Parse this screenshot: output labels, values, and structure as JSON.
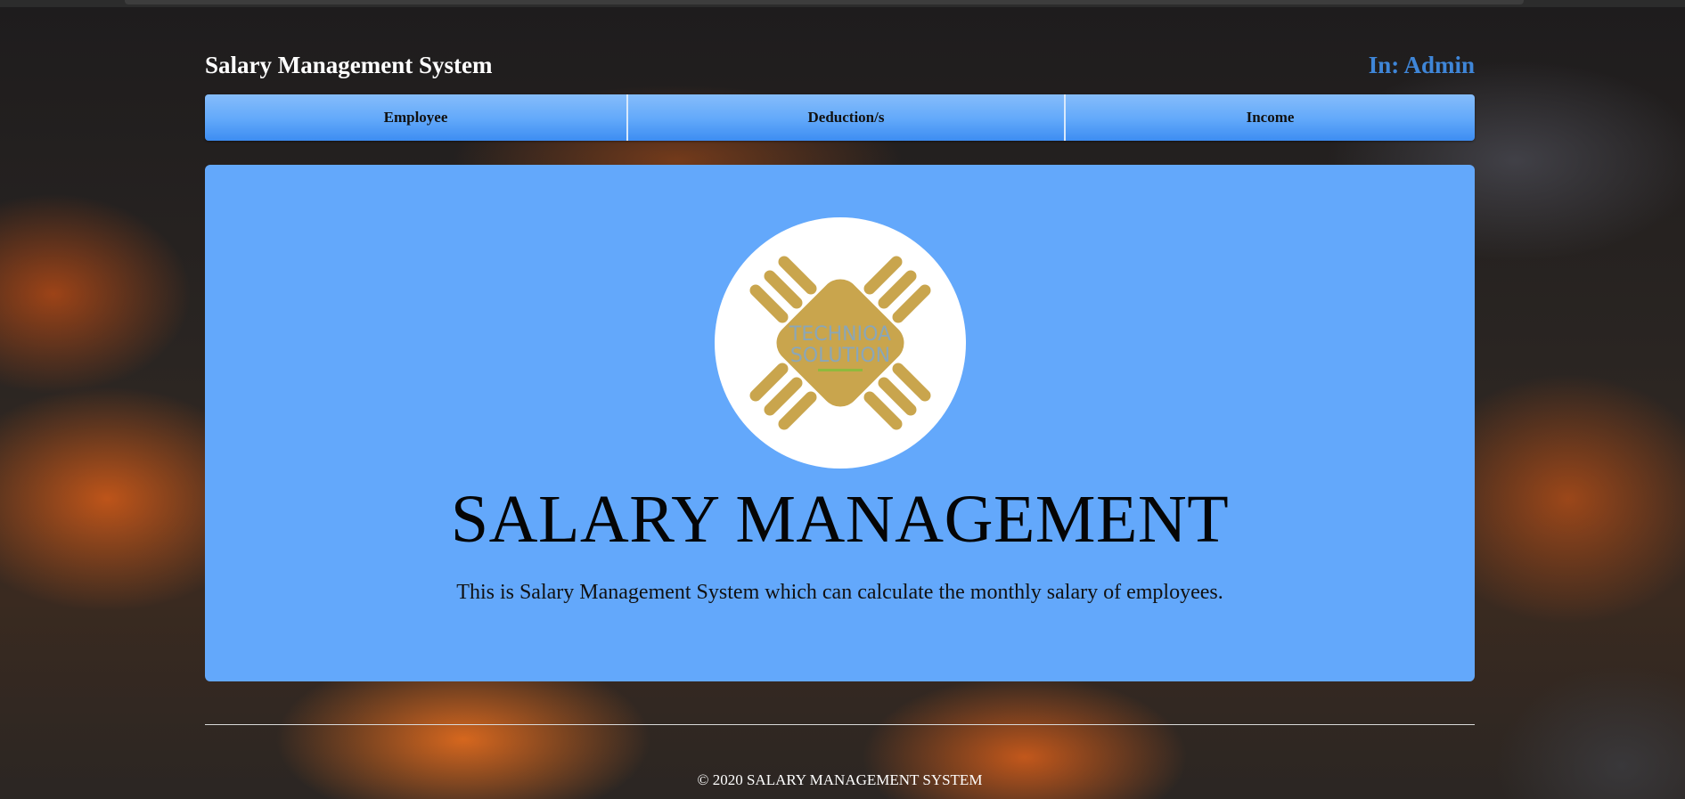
{
  "header": {
    "brand": "Salary Management System",
    "user": "In: Admin"
  },
  "nav": {
    "items": [
      {
        "label": "Employee"
      },
      {
        "label": "Deduction/s"
      },
      {
        "label": "Income"
      }
    ]
  },
  "hero": {
    "logo_text": "TECHNIOA SOLUTION",
    "title": "SALARY MANAGEMENT",
    "description": "This is Salary Management System which can calculate the monthly salary of employees."
  },
  "footer": {
    "text": "© 2020 SALARY MANAGEMENT SYSTEM"
  },
  "colors": {
    "nav_accent": "#61a8fa",
    "panel_bg": "#63a8fb",
    "user_text": "#3f86d8",
    "logo_gold": "#c9a54d"
  }
}
